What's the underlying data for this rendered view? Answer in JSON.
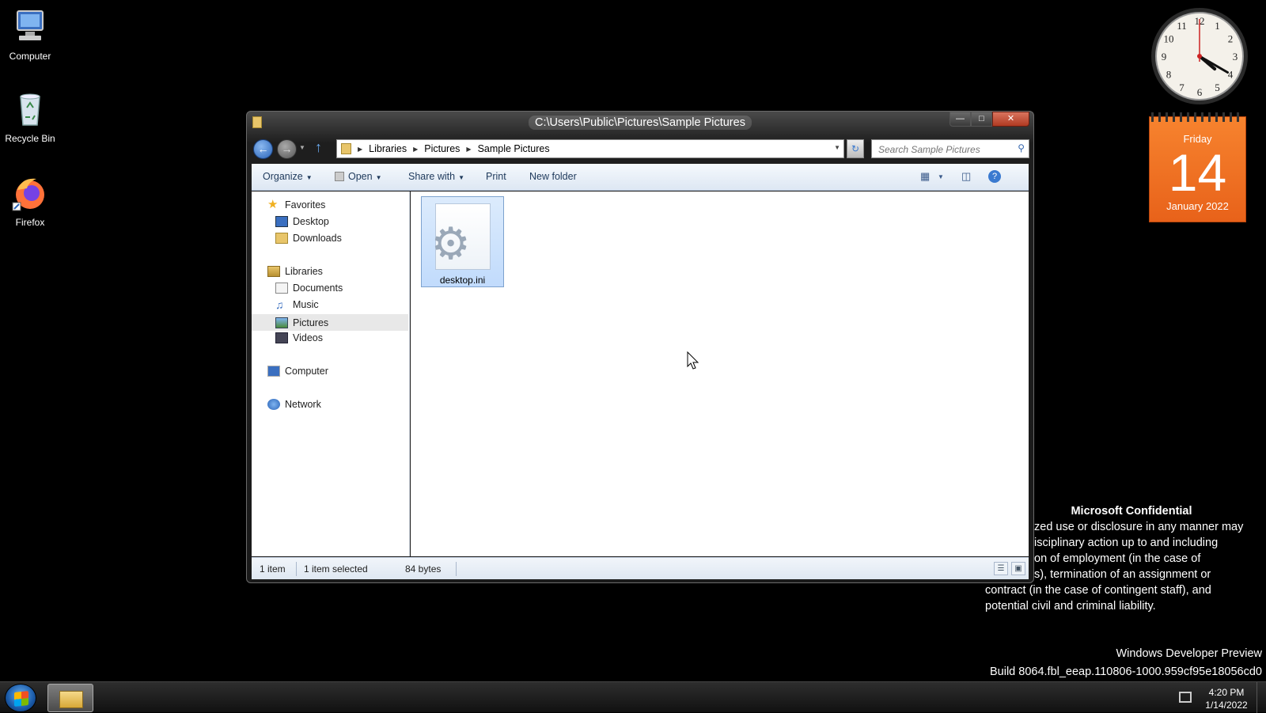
{
  "desktop": {
    "icons": [
      {
        "label": "Computer"
      },
      {
        "label": "Recycle Bin"
      },
      {
        "label": "Firefox"
      }
    ]
  },
  "gadgets": {
    "clock": {
      "hour": 4,
      "minute": 20
    },
    "calendar": {
      "day_name": "Friday",
      "day_number": "14",
      "month_year": "January 2022"
    }
  },
  "confidential": {
    "heading": "Microsoft Confidential",
    "lines": [
      "zed use or disclosure in any manner may",
      "isciplinary action up to and including",
      "on of employment (in the case of",
      "s), termination of an assignment or",
      "contract (in the case of contingent staff), and",
      "potential civil and criminal liability."
    ]
  },
  "watermark": {
    "line1": "Windows Developer Preview",
    "line2": "Build 8064.fbl_eeap.110806-1000.959cf95e18056cd0"
  },
  "window": {
    "title": "C:\\Users\\Public\\Pictures\\Sample Pictures",
    "address": {
      "crumbs": [
        "Libraries",
        "Pictures",
        "Sample Pictures"
      ]
    },
    "search_placeholder": "Search Sample Pictures",
    "commands": {
      "organize": "Organize",
      "open": "Open",
      "share_with": "Share with",
      "print": "Print",
      "new_folder": "New folder"
    },
    "nav": {
      "favorites": "Favorites",
      "desktop": "Desktop",
      "downloads": "Downloads",
      "libraries": "Libraries",
      "documents": "Documents",
      "music": "Music",
      "pictures": "Pictures",
      "videos": "Videos",
      "computer": "Computer",
      "network": "Network"
    },
    "files": [
      {
        "name": "desktop.ini",
        "selected": true
      }
    ],
    "status": {
      "count": "1 item",
      "selected": "1 item selected",
      "size": "84 bytes"
    }
  },
  "taskbar": {
    "time": "4:20 PM",
    "date": "1/14/2022"
  },
  "colors": {
    "calendar_orange": "#f07a25",
    "selection_blue": "#cde0f7",
    "window_frame": "#1e1e1e"
  }
}
